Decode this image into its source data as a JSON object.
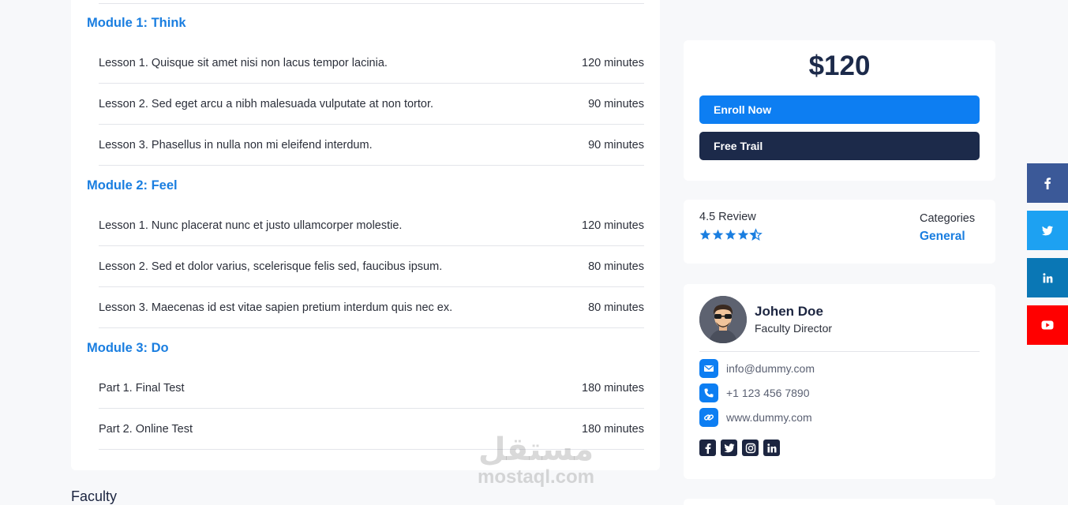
{
  "curriculum": {
    "modules": [
      {
        "title": "Module 1: Think",
        "lessons": [
          {
            "label": "Lesson 1. Quisque sit amet nisi non lacus tempor lacinia.",
            "duration": "120 minutes"
          },
          {
            "label": "Lesson 2. Sed eget arcu a nibh malesuada vulputate at non tortor.",
            "duration": "90 minutes"
          },
          {
            "label": "Lesson 3. Phasellus in nulla non mi eleifend interdum.",
            "duration": "90 minutes"
          }
        ]
      },
      {
        "title": "Module 2: Feel",
        "lessons": [
          {
            "label": "Lesson 1. Nunc placerat nunc et justo ullamcorper molestie.",
            "duration": "120 minutes"
          },
          {
            "label": "Lesson 2. Sed et dolor varius, scelerisque felis sed, faucibus ipsum.",
            "duration": "80 minutes"
          },
          {
            "label": "Lesson 3. Maecenas id est vitae sapien pretium interdum quis nec ex.",
            "duration": "80 minutes"
          }
        ]
      },
      {
        "title": "Module 3: Do",
        "lessons": [
          {
            "label": "Part 1. Final Test",
            "duration": "180 minutes"
          },
          {
            "label": "Part 2. Online Test",
            "duration": "180 minutes"
          }
        ]
      }
    ]
  },
  "faculty_heading": "Faculty",
  "pricing": {
    "price": "$120",
    "enroll_label": "Enroll Now",
    "trail_label": "Free Trail"
  },
  "review": {
    "text": "4.5 Review",
    "rating": 4.5,
    "max_rating": 5,
    "categories_label": "Categories",
    "category_value": "General"
  },
  "profile": {
    "name": "Johen Doe",
    "role": "Faculty Director",
    "email": "info@dummy.com",
    "phone": "+1 123 456 7890",
    "website": "www.dummy.com",
    "social_icons": [
      "facebook-icon",
      "twitter-icon",
      "instagram-icon",
      "linkedin-icon"
    ]
  },
  "share_bar": {
    "buttons": [
      {
        "icon": "facebook-icon",
        "color": "#3b5998"
      },
      {
        "icon": "twitter-icon",
        "color": "#1da1f2"
      },
      {
        "icon": "linkedin-icon",
        "color": "#0a77b5"
      },
      {
        "icon": "youtube-icon",
        "color": "#ff0000"
      }
    ]
  },
  "watermark": {
    "arabic": "مستقل",
    "latin": "mostaql.com"
  },
  "colors": {
    "accent": "#0d7ef2",
    "navy": "#1c2a4a",
    "module_title": "#1a7ee0",
    "background": "#f7f8fa"
  }
}
